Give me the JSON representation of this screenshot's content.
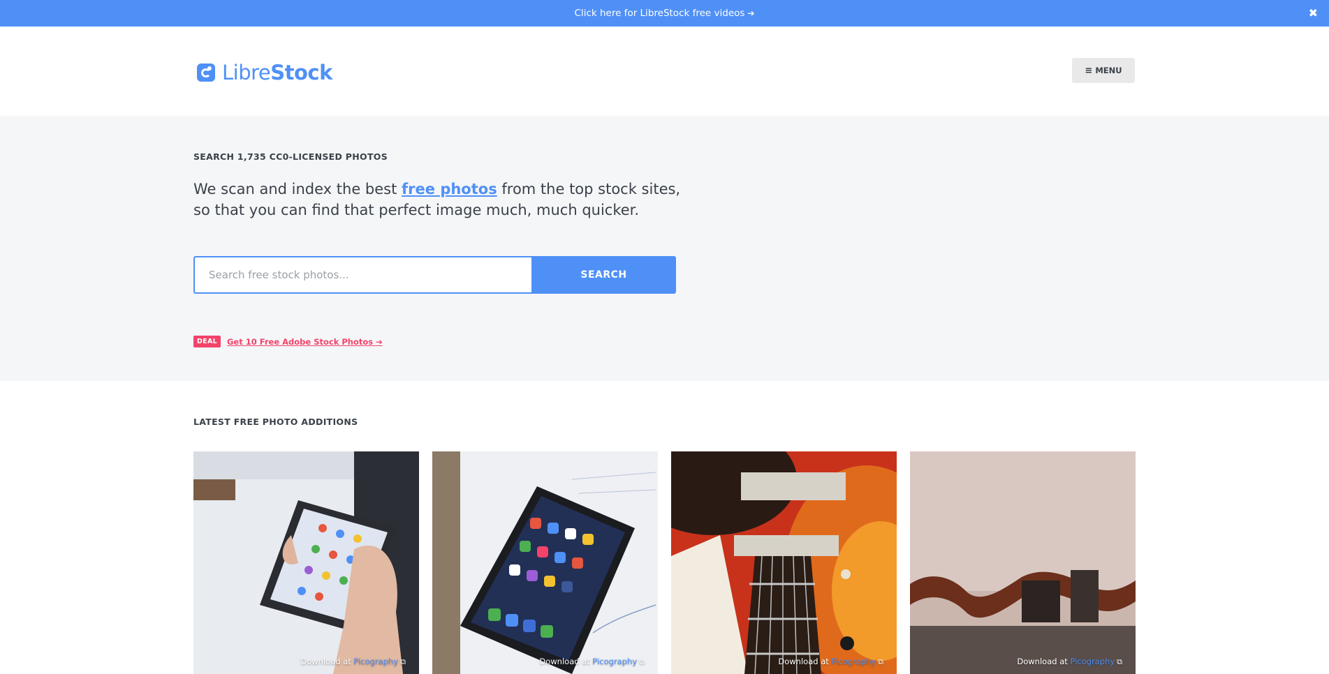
{
  "banner": {
    "text": "Click here for LibreStock free videos",
    "arrow_icon": "arrow-right-icon",
    "close_icon": "close-icon"
  },
  "header": {
    "logo_prefix": "Libre",
    "logo_suffix": "Stock",
    "menu_label": "MENU",
    "menu_icon": "bars-icon"
  },
  "hero": {
    "eyebrow": "SEARCH 1,735 CC0-LICENSED PHOTOS",
    "lead_before": "We scan and index the best ",
    "lead_link": "free photos",
    "lead_after": " from the top stock sites, so that you can find that perfect image much, much quicker.",
    "search_placeholder": "Search free stock photos...",
    "search_button": "SEARCH",
    "deal_badge": "DEAL",
    "deal_link": "Get 10 Free Adobe Stock Photos",
    "deal_arrow_icon": "arrow-right-icon"
  },
  "latest": {
    "title": "LATEST FREE PHOTO ADDITIONS",
    "photos": [
      {
        "subject": "hand holding android phone",
        "download_prefix": "Download at",
        "source": "Picography",
        "external_icon": "external-link-icon"
      },
      {
        "subject": "iphone on notebook",
        "download_prefix": "Download at",
        "source": "Picography",
        "external_icon": "external-link-icon"
      },
      {
        "subject": "electric guitar closeup",
        "download_prefix": "Download at",
        "source": "Picography",
        "external_icon": "external-link-icon"
      },
      {
        "subject": "film roll on table",
        "download_prefix": "Download at",
        "source": "Picography",
        "external_icon": "external-link-icon"
      }
    ]
  },
  "colors": {
    "brand": "#4f90f6",
    "deal": "#f2436a",
    "hero_bg": "#f5f6f8",
    "text": "#3a4149"
  }
}
